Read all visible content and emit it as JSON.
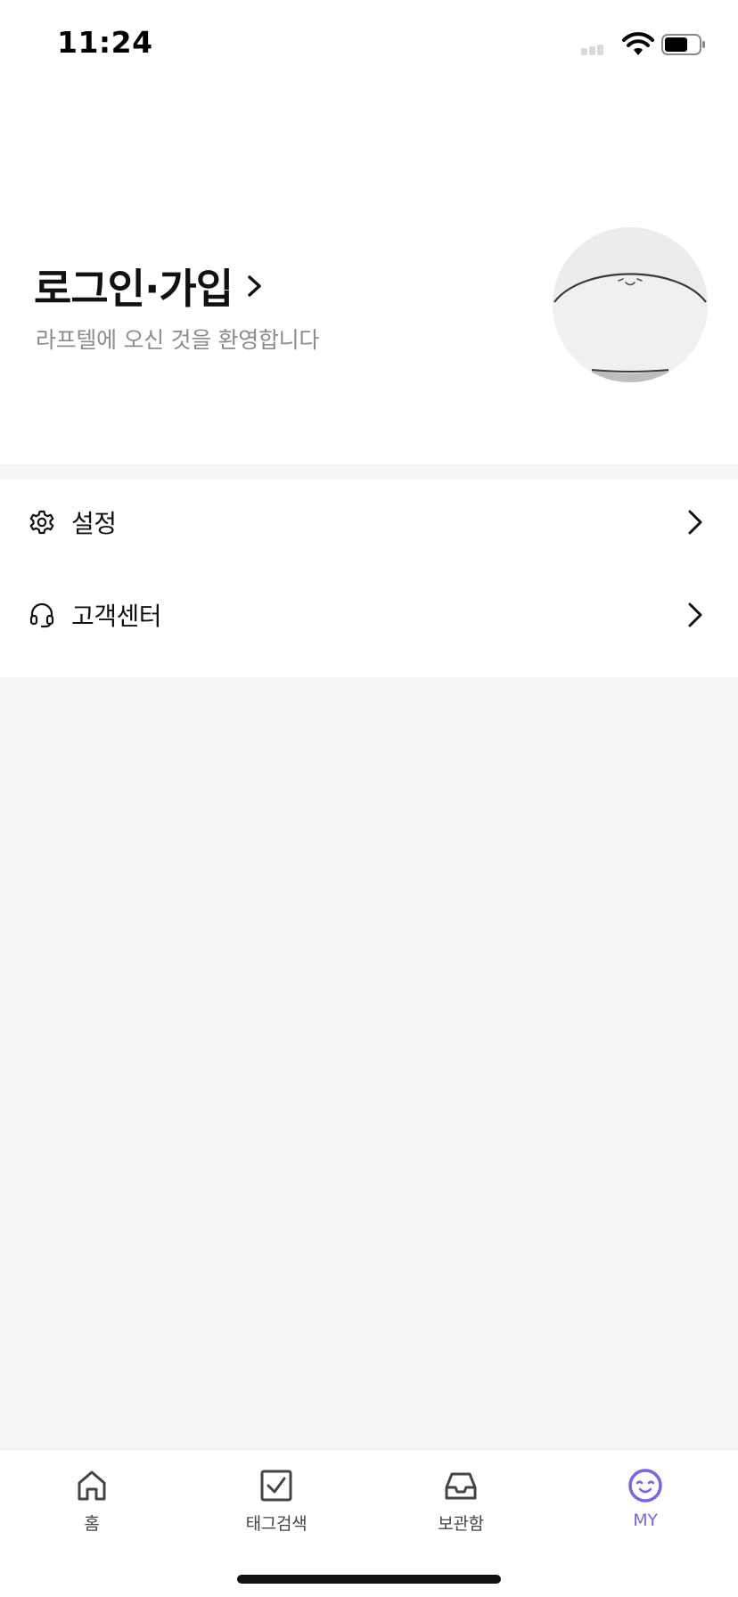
{
  "status_bar": {
    "time": "11:24"
  },
  "profile": {
    "login_title": "로그인·가입",
    "welcome_text": "라프텔에 오신 것을 환영합니다",
    "avatar_icon": "smiling-face-avatar"
  },
  "menu": {
    "items": [
      {
        "label": "설정",
        "icon": "gear-icon"
      },
      {
        "label": "고객센터",
        "icon": "headset-icon"
      }
    ]
  },
  "tab_bar": {
    "tabs": [
      {
        "label": "홈",
        "icon": "home-icon",
        "active": false
      },
      {
        "label": "태그검색",
        "icon": "checkbox-icon",
        "active": false
      },
      {
        "label": "보관함",
        "icon": "inbox-icon",
        "active": false
      },
      {
        "label": "MY",
        "icon": "smile-face-icon",
        "active": true
      }
    ]
  },
  "colors": {
    "accent": "#7c64e6",
    "background": "#f5f5f5",
    "text_primary": "#111111",
    "text_secondary": "#8c8c8c"
  }
}
